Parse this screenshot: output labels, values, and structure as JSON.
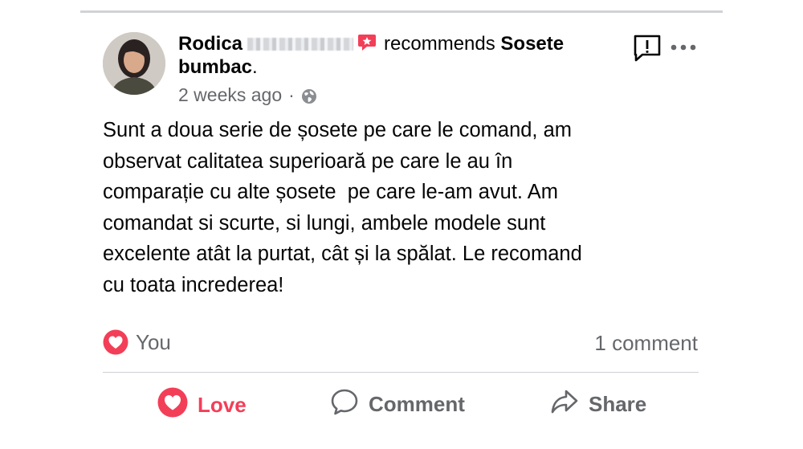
{
  "post": {
    "author_name": "Rodica",
    "verb": "recommends",
    "page_name": "Sosete bumbac",
    "page_suffix": ".",
    "timestamp": "2 weeks ago",
    "separator": "·",
    "privacy_icon": "globe-icon",
    "text": "Sunt a doua serie de șosete pe care le comand, am\nobservat calitatea superioară pe care le au în\ncomparație cu alte șosete  pe care le-am avut. Am\ncomandat si scurte, si lungi, ambele modele sunt\nexcelente atât la purtat, cât și la spălat. Le recomand\ncu toata increderea!"
  },
  "reactions": {
    "icon": "love-emoji",
    "label": "You",
    "comment_count": "1 comment"
  },
  "actions": {
    "love": "Love",
    "comment": "Comment",
    "share": "Share"
  },
  "colors": {
    "love": "#f33e58",
    "secondary_text": "#65676b",
    "primary_text": "#050505",
    "divider": "#ced0d4"
  }
}
